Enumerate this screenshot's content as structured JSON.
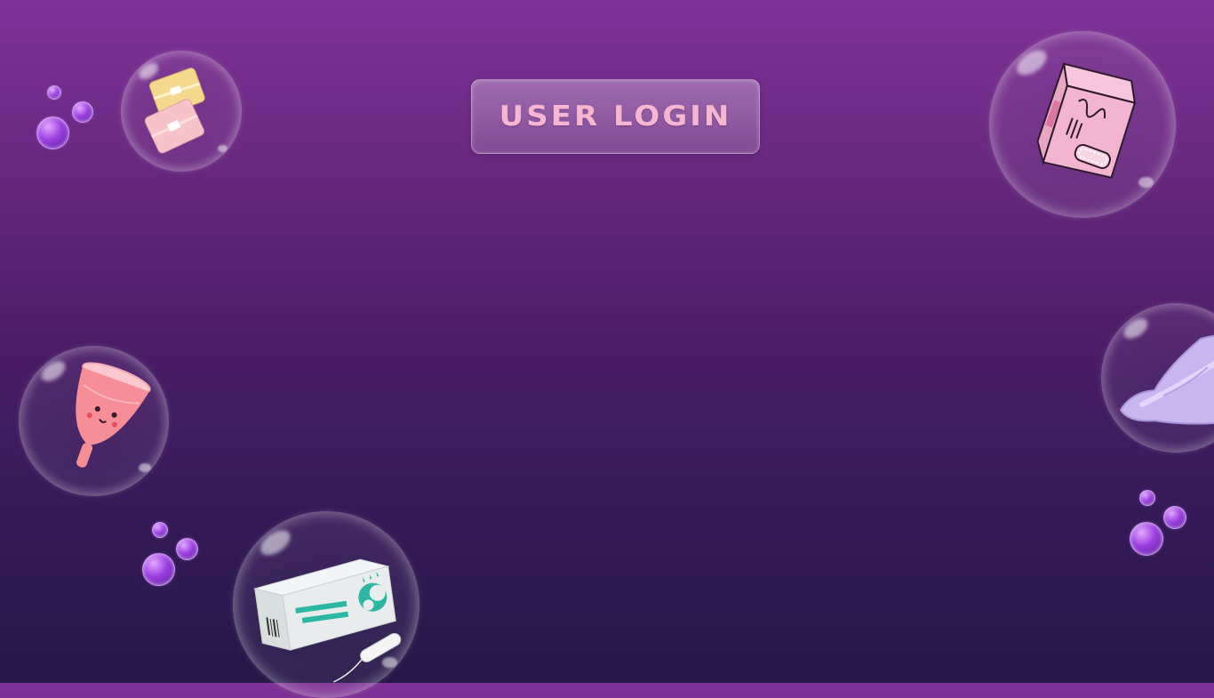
{
  "login": {
    "label": "USER LOGIN"
  },
  "bubbles": [
    {
      "id": "pads-small",
      "icon": "pantyliner-icon"
    },
    {
      "id": "pad-box",
      "icon": "pad-box-icon"
    },
    {
      "id": "menstrual-cup",
      "icon": "menstrual-cup-icon"
    },
    {
      "id": "sanitary-pad",
      "icon": "sanitary-pad-icon"
    },
    {
      "id": "tampon-box",
      "icon": "tampon-box-icon"
    }
  ],
  "colors": {
    "accent": "#f7b6d0",
    "background_top": "#7f3196",
    "background_bottom": "#261848"
  }
}
